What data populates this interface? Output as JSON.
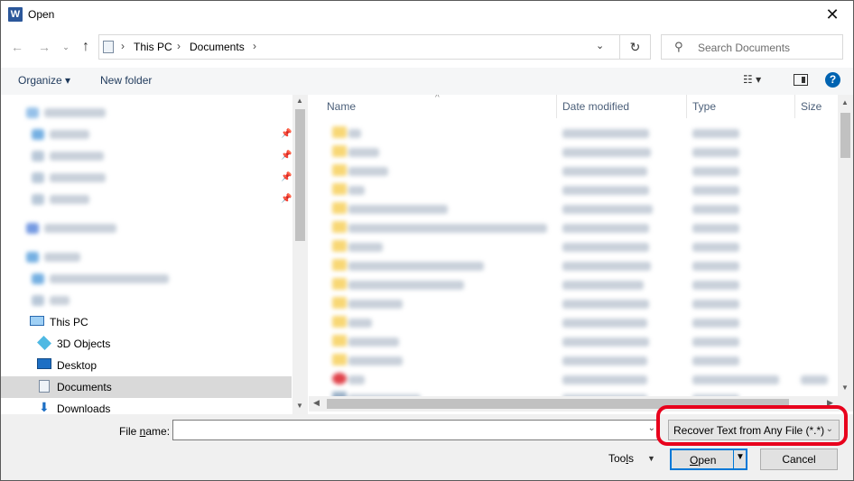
{
  "window": {
    "title": "Open",
    "app_icon_letter": "W",
    "close_glyph": "✕"
  },
  "nav": {
    "back_glyph": "←",
    "forward_glyph": "→",
    "recent_glyph": "⌄",
    "up_glyph": "↑",
    "breadcrumb": [
      "This PC",
      "Documents"
    ],
    "sep": "›",
    "refresh_glyph": "↻",
    "dropdown_glyph": "⌄"
  },
  "search": {
    "placeholder": "Search Documents",
    "icon_glyph": "⚲"
  },
  "toolbar": {
    "organize": "Organize ▾",
    "new_folder": "New folder",
    "view_glyph": "☷ ▾",
    "help": "?"
  },
  "navpane": {
    "items": [
      {
        "label": "This PC"
      },
      {
        "label": "3D Objects"
      },
      {
        "label": "Desktop"
      },
      {
        "label": "Documents",
        "selected": true
      },
      {
        "label": "Downloads"
      }
    ]
  },
  "filelist": {
    "columns": [
      "Name",
      "Date modified",
      "Type",
      "Size"
    ],
    "sort_glyph": "^"
  },
  "scroll": {
    "up": "▲",
    "down": "▼",
    "left": "◀",
    "right": "▶"
  },
  "bottom": {
    "file_name_label_pre": "File ",
    "file_name_label_u": "n",
    "file_name_label_post": "ame:",
    "file_name_value": "",
    "filter": "Recover Text from Any File (*.*)",
    "tools_pre": "Too",
    "tools_u": "l",
    "tools_post": "s",
    "open_u": "O",
    "open_post": "pen",
    "cancel": "Cancel",
    "dd_glyph": "⌄"
  },
  "colors": {
    "highlight": "#e8001c",
    "accent": "#0078d7",
    "folder": "#f8d775"
  }
}
